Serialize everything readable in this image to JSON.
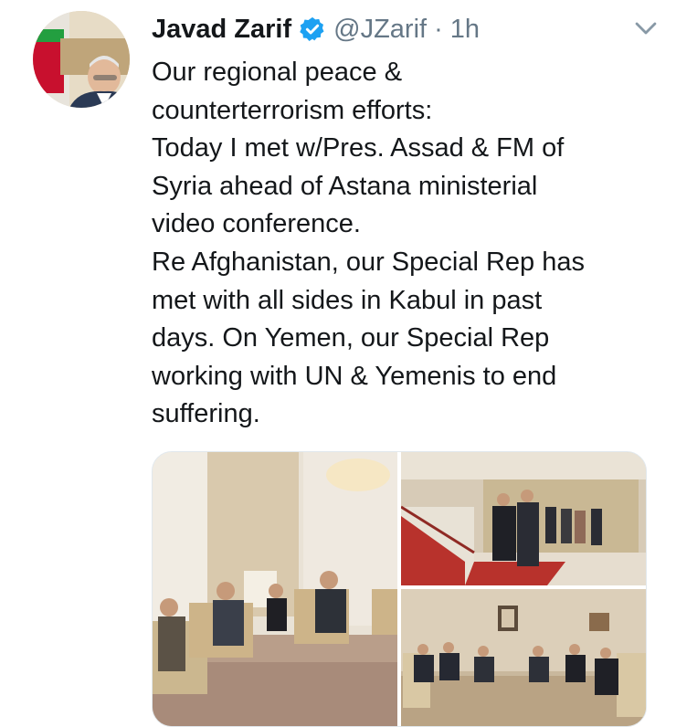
{
  "tweet": {
    "display_name": "Javad Zarif",
    "handle": "@JZarif",
    "separator": "·",
    "time": "1h",
    "verified_icon": "verified-badge-icon",
    "menu_icon": "chevron-down-icon",
    "text": "Our regional peace &\ncounterterrorism efforts:\nToday I met w/Pres. Assad & FM of\nSyria ahead of Astana ministerial\nvideo conference.\nRe Afghanistan, our Special Rep has\nmet with all sides in Kabul in past\ndays. On Yemen, our Special Rep\nworking with UN & Yemenis to end\nsuffering."
  },
  "colors": {
    "accent": "#1da1f2",
    "secondary_text": "#657786",
    "primary_text": "#14171a"
  }
}
